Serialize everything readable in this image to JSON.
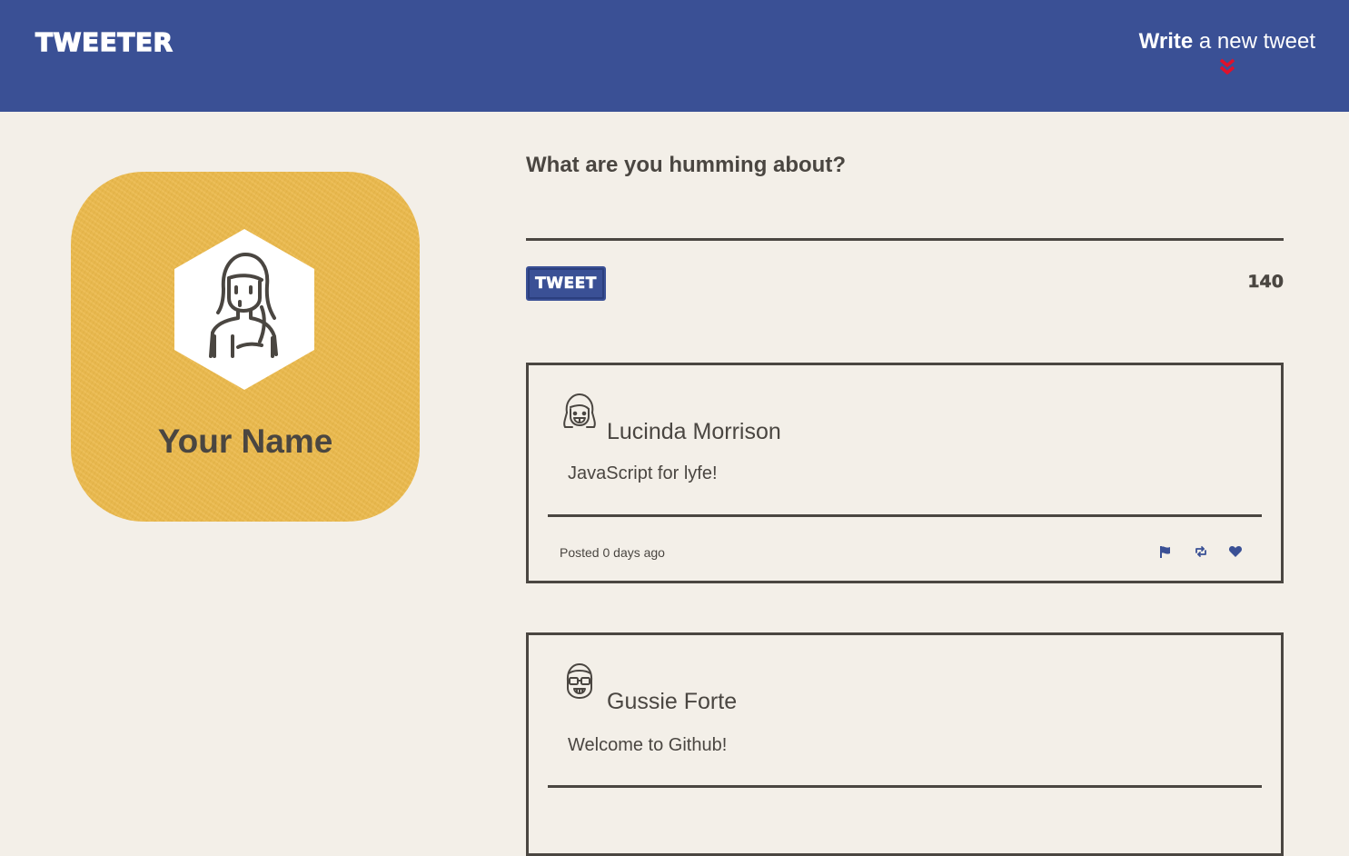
{
  "nav": {
    "brand": "TWEETER",
    "compose_strong": "Write",
    "compose_rest": " a new tweet",
    "compose_icon": "double-chevron-down-icon",
    "accent_color": "#e0112b",
    "bar_color": "#3a5095"
  },
  "profile": {
    "name": "Your Name",
    "avatar_icon": "user-avatar-icon",
    "card_color": "#ebb94a"
  },
  "composer": {
    "prompt": "What are you humming about?",
    "input_value": "",
    "submit_label": "TWEET",
    "char_counter": "140"
  },
  "tweets": [
    {
      "author": "Lucinda Morrison",
      "avatar_icon": "smiling-girl-avatar-icon",
      "content": "JavaScript for lyfe!",
      "posted": "Posted 0 days ago",
      "actions": [
        "flag-icon",
        "retweet-icon",
        "heart-icon"
      ]
    },
    {
      "author": "Gussie Forte",
      "avatar_icon": "glasses-avatar-icon",
      "content": "Welcome to Github!",
      "posted": "",
      "actions": []
    }
  ]
}
